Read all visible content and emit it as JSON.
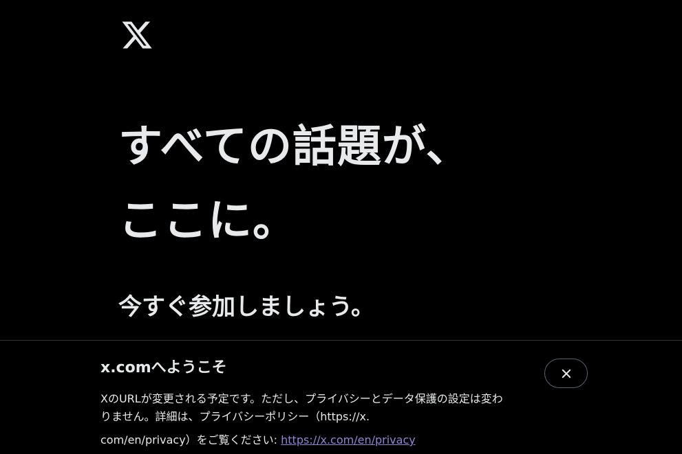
{
  "brand": {
    "logo_icon": "x-logo-icon",
    "text_color": "#e7e9ea",
    "background": "#000000"
  },
  "hero": {
    "headline_line1": "すべての話題が、",
    "headline_line2": "ここに。",
    "subheading": "今すぐ参加しましょう。"
  },
  "banner": {
    "title": "x.comへようこそ",
    "body_line1": "XのURLが変更される予定です。ただし、プライバシーとデータ保護の設定は変わ",
    "body_line2": "りません。詳細は、プライバシーポリシー（https://x.",
    "body_line3_prefix": "com/en/privacy）をご覧ください: ",
    "privacy_link": "https://x.com/en/privacy",
    "link_color": "#8e86d6",
    "close_icon": "close-icon"
  }
}
